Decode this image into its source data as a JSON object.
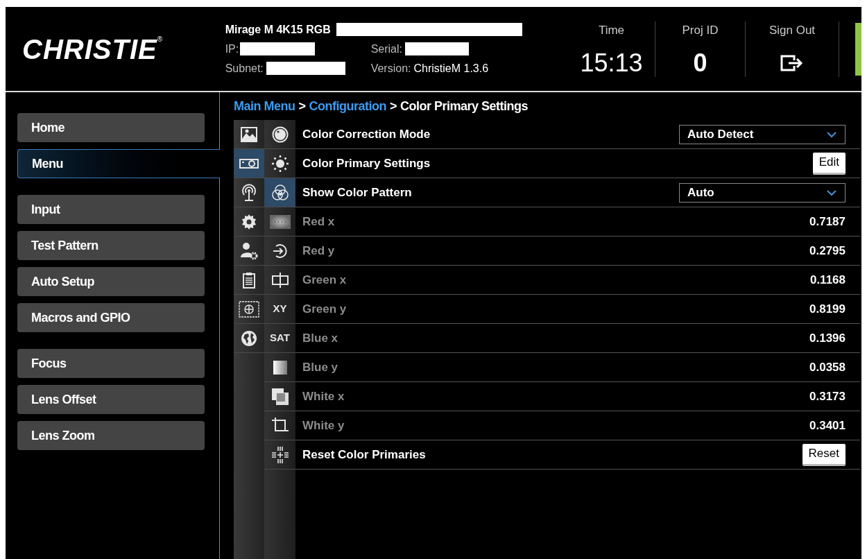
{
  "header": {
    "brand": "CHRISTIE",
    "brand_mark": "®",
    "model": "Mirage M 4K15 RGB",
    "ip_label": "IP:",
    "serial_label": "Serial:",
    "subnet_label": "Subnet:",
    "version_label": "Version:",
    "version": "ChristieM 1.3.6",
    "time_label": "Time",
    "time": "15:13",
    "proj_id_label": "Proj ID",
    "proj_id": "0",
    "sign_out_label": "Sign Out"
  },
  "sidebar": {
    "groups": [
      [
        {
          "label": "Home",
          "selected": false
        },
        {
          "label": "Menu",
          "selected": true
        }
      ],
      [
        {
          "label": "Input",
          "selected": false
        },
        {
          "label": "Test Pattern",
          "selected": false
        },
        {
          "label": "Auto Setup",
          "selected": false
        },
        {
          "label": "Macros and GPIO",
          "selected": false
        }
      ],
      [
        {
          "label": "Focus",
          "selected": false
        },
        {
          "label": "Lens Offset",
          "selected": false
        },
        {
          "label": "Lens Zoom",
          "selected": false
        }
      ]
    ]
  },
  "breadcrumb": [
    {
      "kind": "link",
      "text": "Main Menu"
    },
    {
      "kind": "separator",
      "text": ">"
    },
    {
      "kind": "link",
      "text": "Configuration"
    },
    {
      "kind": "separator",
      "text": ">"
    },
    {
      "kind": "current",
      "text": "Color Primary Settings"
    }
  ],
  "category_icons": [
    {
      "kind": "picture",
      "selected": false
    },
    {
      "kind": "projector",
      "selected": true
    },
    {
      "kind": "antenna",
      "selected": false
    },
    {
      "kind": "gear",
      "selected": false
    },
    {
      "kind": "user-gear",
      "selected": false
    },
    {
      "kind": "clipboard",
      "selected": false
    },
    {
      "kind": "target",
      "selected": false
    },
    {
      "kind": "globe",
      "selected": false
    }
  ],
  "submenu_icons": [
    {
      "kind": "circle",
      "selected": false
    },
    {
      "kind": "sun",
      "selected": false
    },
    {
      "kind": "color-circles",
      "selected": true
    },
    {
      "kind": "dots",
      "selected": false
    },
    {
      "kind": "input",
      "selected": false
    },
    {
      "kind": "split",
      "selected": false
    },
    {
      "kind": "text",
      "text": "XY",
      "selected": false
    },
    {
      "kind": "text",
      "text": "SAT",
      "selected": false
    },
    {
      "kind": "gradient",
      "selected": false
    },
    {
      "kind": "overlay",
      "selected": false
    },
    {
      "kind": "crop",
      "selected": false
    },
    {
      "kind": "grid",
      "selected": false
    }
  ],
  "settings": [
    {
      "kind": "select",
      "label": "Color Correction Mode",
      "value": "Auto Detect"
    },
    {
      "kind": "button",
      "label": "Color Primary Settings",
      "button": "Edit"
    },
    {
      "kind": "select",
      "label": "Show Color Pattern",
      "value": "Auto"
    },
    {
      "kind": "value",
      "label": "Red x",
      "value": "0.7187"
    },
    {
      "kind": "value",
      "label": "Red y",
      "value": "0.2795"
    },
    {
      "kind": "value",
      "label": "Green x",
      "value": "0.1168"
    },
    {
      "kind": "value",
      "label": "Green y",
      "value": "0.8199"
    },
    {
      "kind": "value",
      "label": "Blue x",
      "value": "0.1396"
    },
    {
      "kind": "value",
      "label": "Blue y",
      "value": "0.0358"
    },
    {
      "kind": "value",
      "label": "White x",
      "value": "0.3173"
    },
    {
      "kind": "value",
      "label": "White y",
      "value": "0.3401"
    },
    {
      "kind": "button",
      "label": "Reset Color Primaries",
      "button": "Reset"
    }
  ]
}
